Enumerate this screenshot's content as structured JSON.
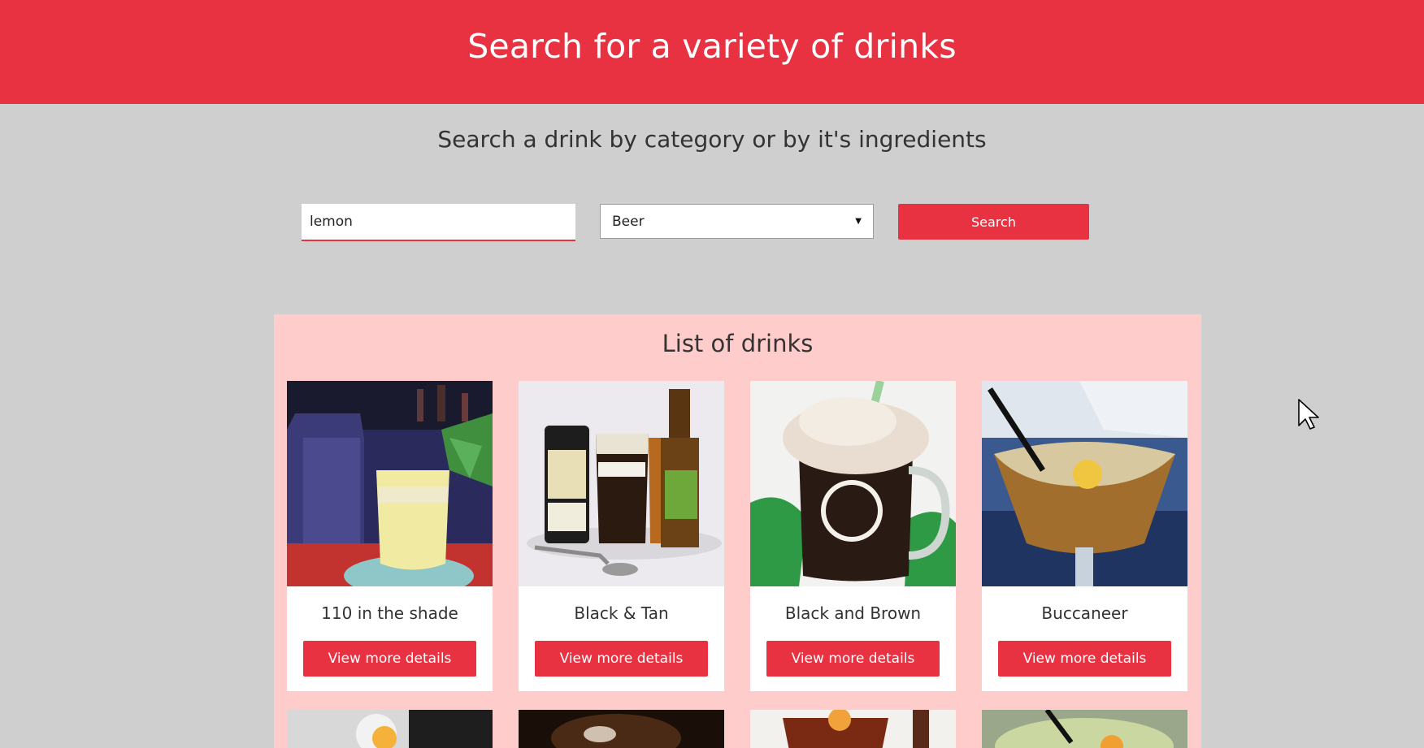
{
  "header": {
    "title": "Search for a variety of drinks"
  },
  "subtitle": "Search a drink by category or by it's ingredients",
  "search": {
    "input_value": "lemon",
    "category_selected": "Beer",
    "button_label": "Search"
  },
  "list": {
    "title": "List of drinks",
    "button_label": "View more details",
    "drinks": [
      {
        "name": "110 in the shade"
      },
      {
        "name": "Black & Tan"
      },
      {
        "name": "Black and Brown"
      },
      {
        "name": "Buccaneer"
      }
    ]
  },
  "colors": {
    "accent": "#e83242",
    "background": "#cfcfcf",
    "panel": "#ffcccc"
  }
}
